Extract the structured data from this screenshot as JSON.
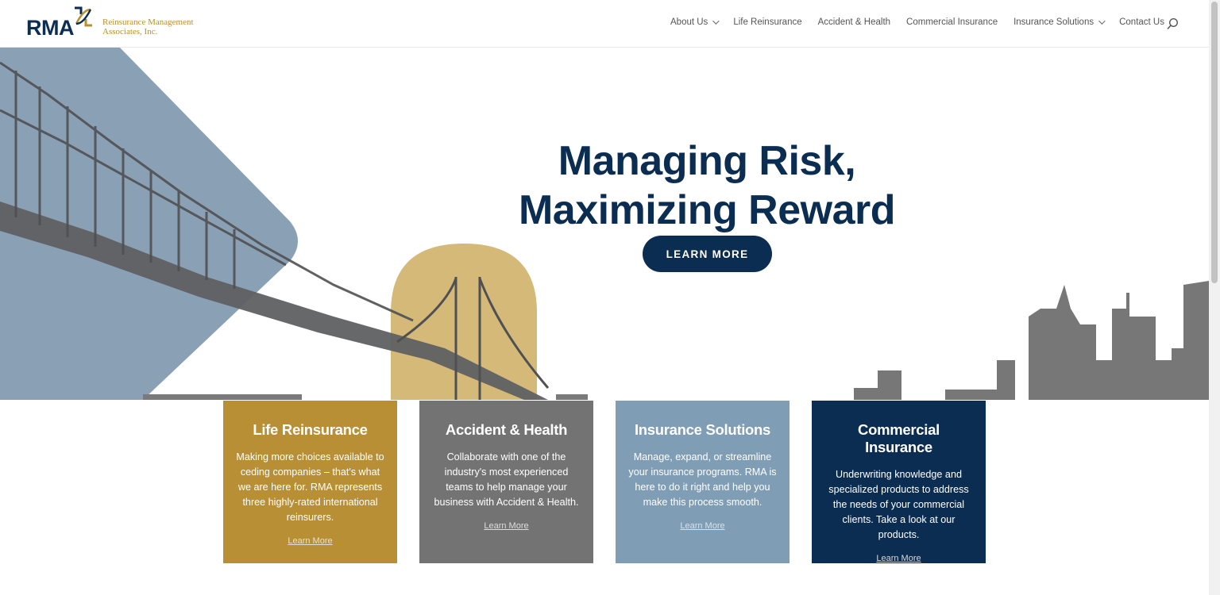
{
  "brand": {
    "logo_abbr": "RMA",
    "logo_line1": "Reinsurance Management",
    "logo_line2": "Associates, Inc.",
    "colors": {
      "navy": "#0c2d52",
      "gold": "#b98f2f",
      "gray": "#737373",
      "steel": "#7e9cb5"
    }
  },
  "nav": {
    "items": [
      {
        "label": "About Us",
        "has_dropdown": true
      },
      {
        "label": "Life Reinsurance",
        "has_dropdown": false
      },
      {
        "label": "Accident & Health",
        "has_dropdown": false
      },
      {
        "label": "Commercial Insurance",
        "has_dropdown": false
      },
      {
        "label": "Insurance Solutions",
        "has_dropdown": true
      },
      {
        "label": "Contact Us",
        "has_dropdown": false
      }
    ],
    "search_icon": "search-icon"
  },
  "hero": {
    "title_line1": "Managing Risk,",
    "title_line2": "Maximizing Reward",
    "cta_label": "LEARN MORE"
  },
  "cards": [
    {
      "title": "Life Reinsurance",
      "text": "Making more choices available to ceding companies – that's what we are here for. RMA represents three highly-rated international reinsurers.",
      "link": "Learn More",
      "color": "#b98f35"
    },
    {
      "title": "Accident & Health",
      "text": "Collaborate with one of the industry's most experienced teams to help manage your business with Accident & Health.",
      "link": "Learn More",
      "color": "#737373"
    },
    {
      "title": "Insurance Solutions",
      "text": "Manage, expand, or streamline your insurance programs. RMA is here to do it right and help you make this process smooth.",
      "link": "Learn More",
      "color": "#7f9db5"
    },
    {
      "title": "Commercial Insurance",
      "text": "Underwriting knowledge and specialized products to address the needs of your commercial clients. Take a look at our products.",
      "link": "Learn More",
      "color": "#0c2d52"
    }
  ]
}
